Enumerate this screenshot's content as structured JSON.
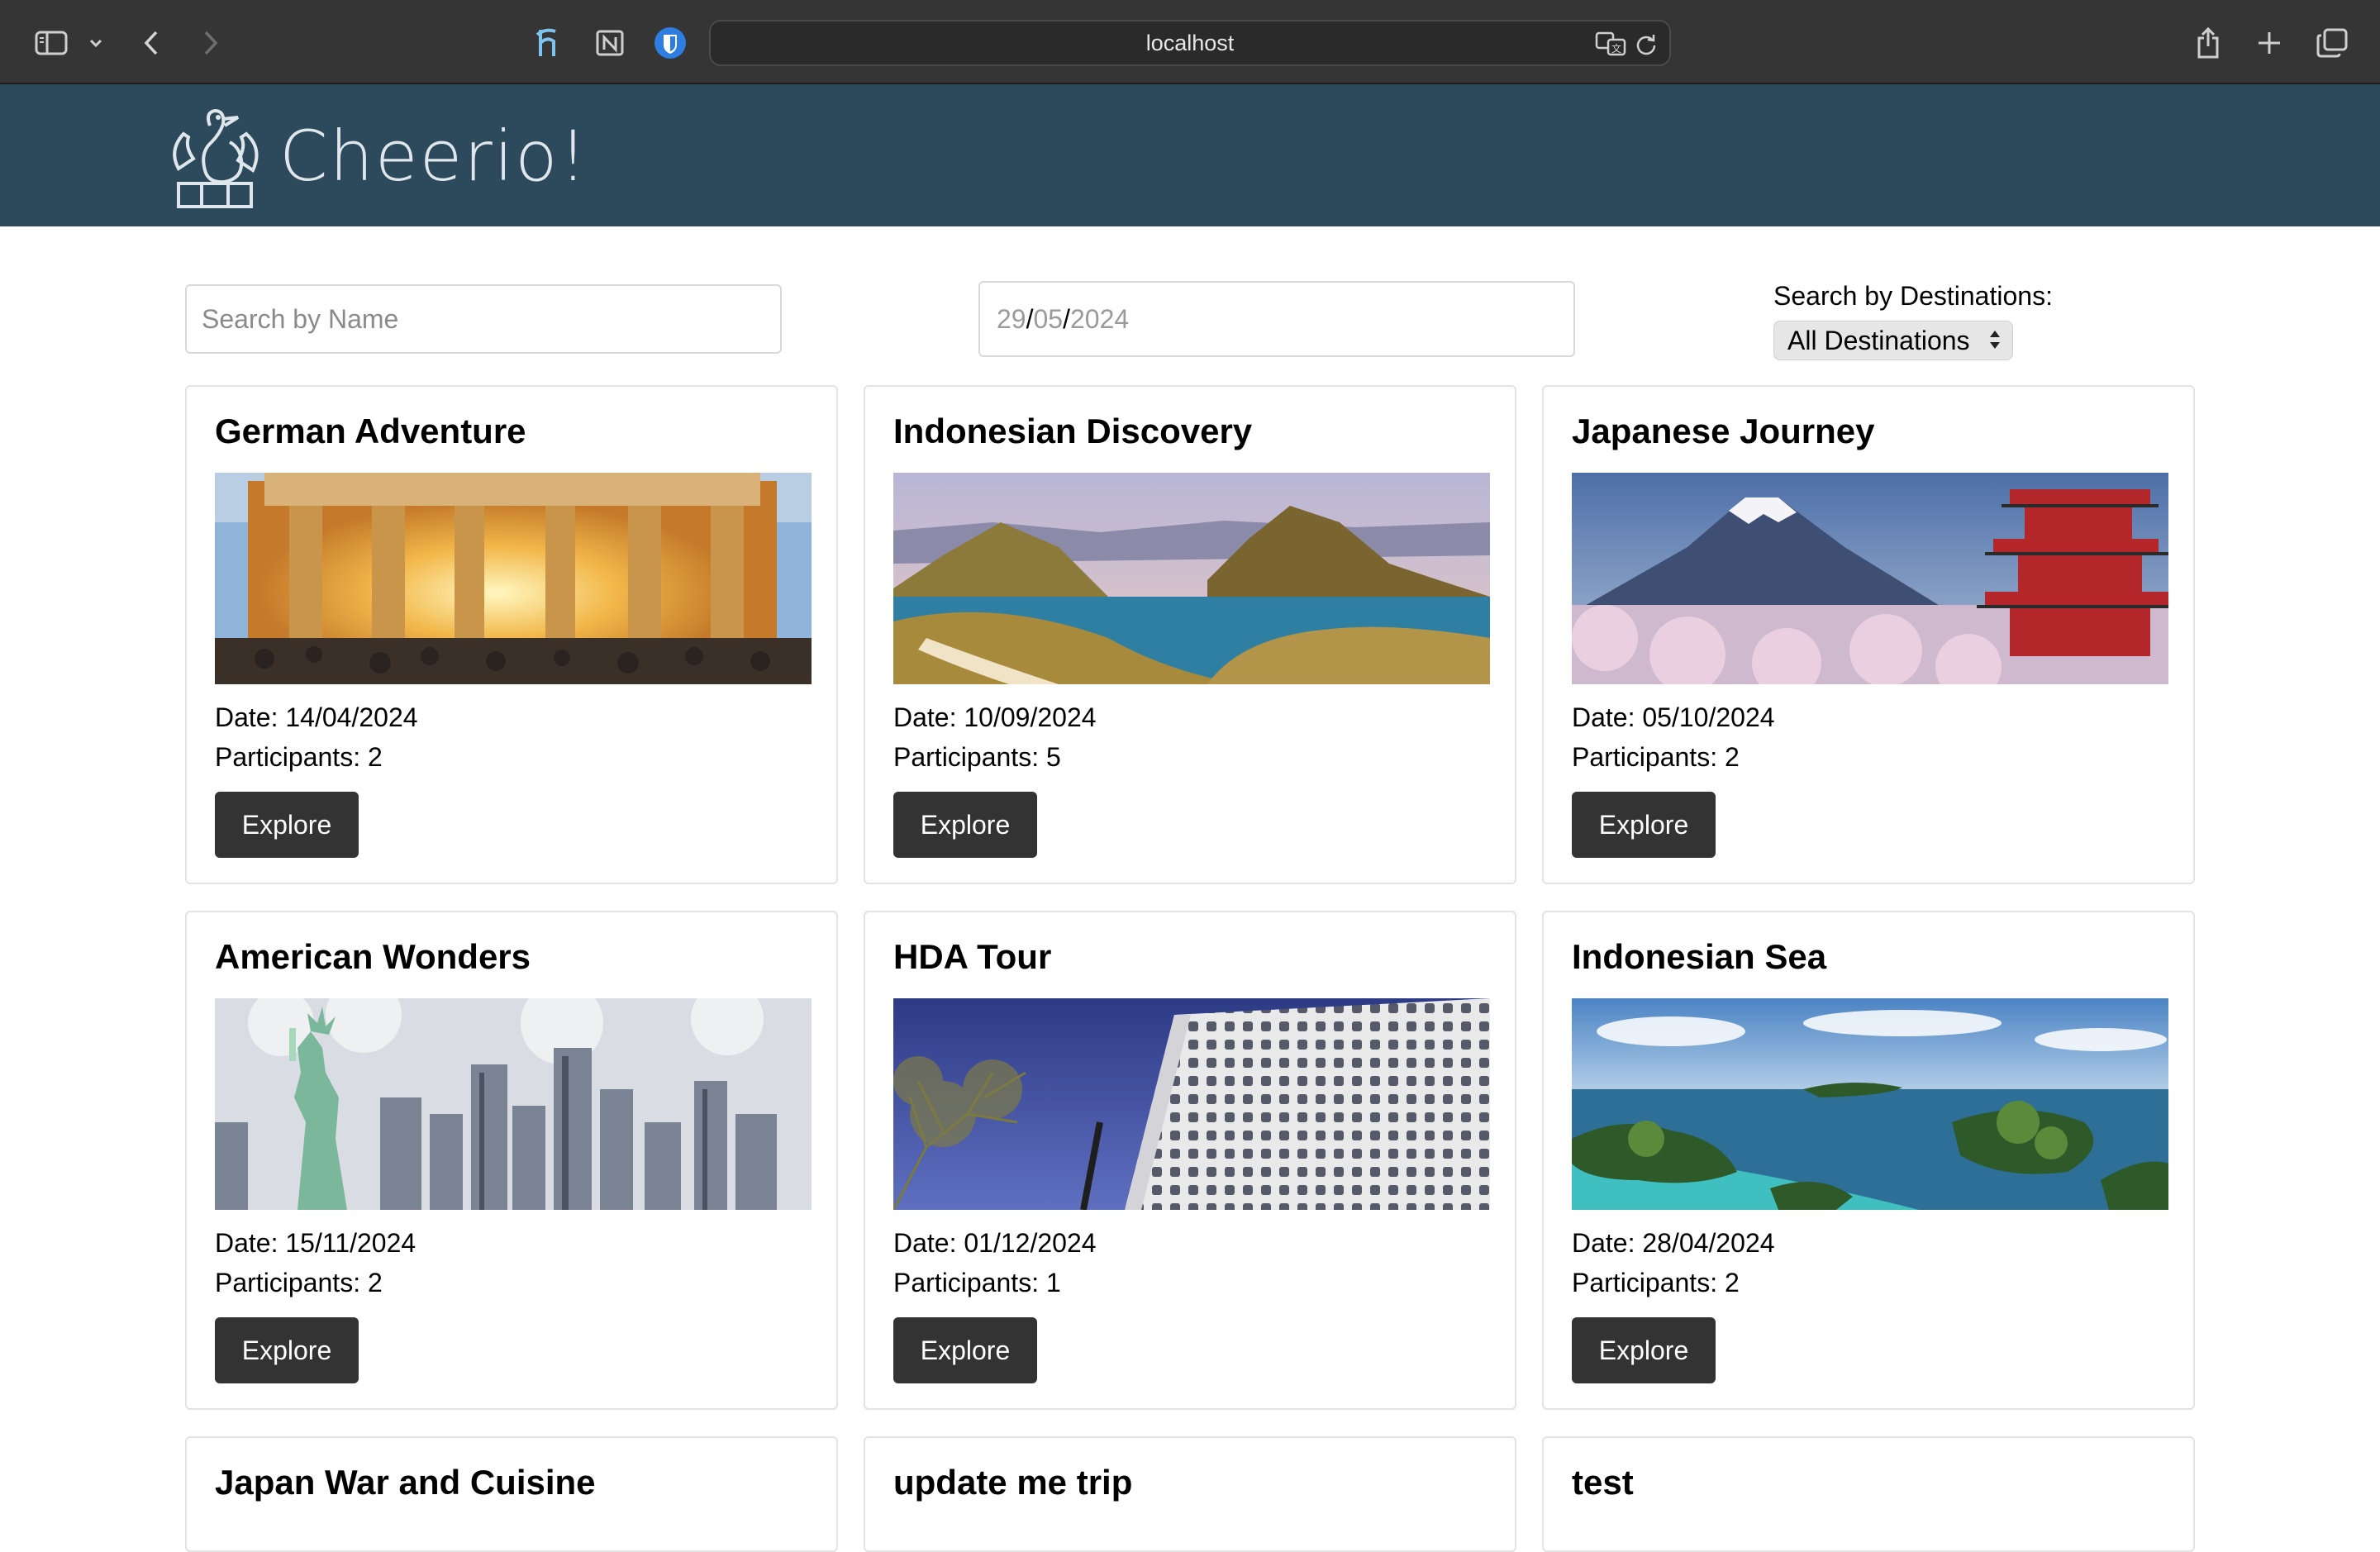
{
  "browser": {
    "url": "localhost",
    "icons": [
      "sidebar-icon",
      "chevron-down-icon",
      "back-icon",
      "forward-icon",
      "honey-extension-icon",
      "notion-extension-icon",
      "bitwarden-extension-icon",
      "translate-icon",
      "reload-icon",
      "share-icon",
      "new-tab-icon",
      "tab-overview-icon"
    ]
  },
  "header": {
    "brand": "Cheerio!",
    "background_color": "#2d4a5c"
  },
  "filters": {
    "search_placeholder": "Search by Name",
    "date_day": "29",
    "date_month": "05",
    "date_year": "2024",
    "date_separator": "/",
    "destinations_label": "Search by Destinations:",
    "destinations_selected": "All Destinations"
  },
  "trips": [
    {
      "title": "German Adventure",
      "date": "Date: 14/04/2024",
      "participants": "Participants: 2",
      "button": "Explore",
      "image": "brandenburg-gate"
    },
    {
      "title": "Indonesian Discovery",
      "date": "Date: 10/09/2024",
      "participants": "Participants: 5",
      "button": "Explore",
      "image": "padar-island"
    },
    {
      "title": "Japanese Journey",
      "date": "Date: 05/10/2024",
      "participants": "Participants: 2",
      "button": "Explore",
      "image": "mount-fuji-pagoda"
    },
    {
      "title": "American Wonders",
      "date": "Date: 15/11/2024",
      "participants": "Participants: 2",
      "button": "Explore",
      "image": "statue-of-liberty"
    },
    {
      "title": "HDA Tour",
      "date": "Date: 01/12/2024",
      "participants": "Participants: 1",
      "button": "Explore",
      "image": "modern-building"
    },
    {
      "title": "Indonesian Sea",
      "date": "Date: 28/04/2024",
      "participants": "Participants: 2",
      "button": "Explore",
      "image": "tropical-islands"
    },
    {
      "title": "Japan War and Cuisine"
    },
    {
      "title": "update me trip"
    },
    {
      "title": "test"
    }
  ],
  "colors": {
    "button": "#333333",
    "toolbar": "#353535"
  }
}
